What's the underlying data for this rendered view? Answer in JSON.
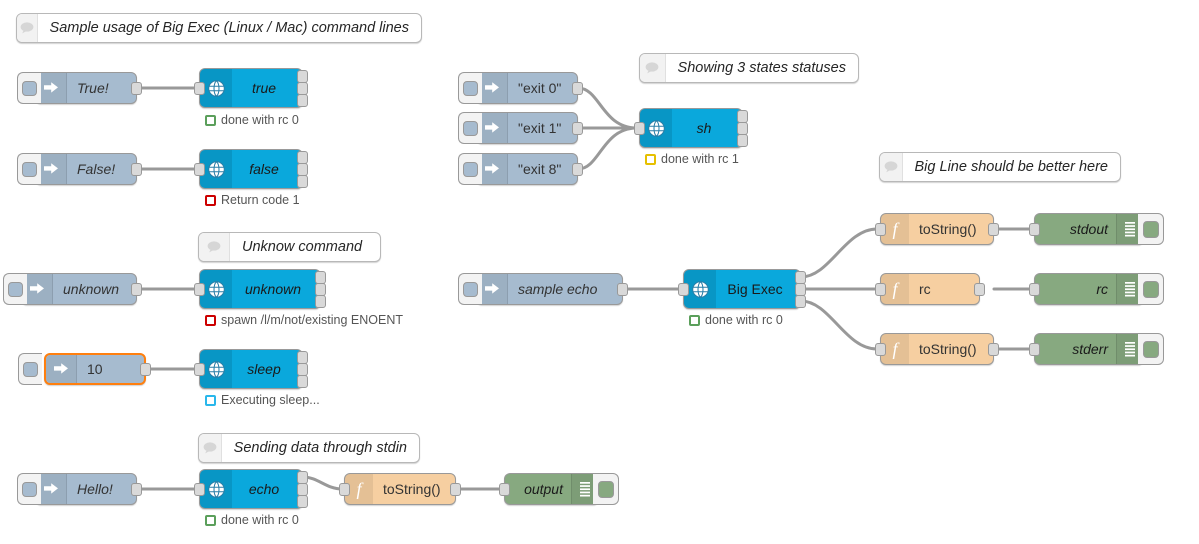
{
  "app": {
    "name": "Node-RED flow editor canvas",
    "background": "#ffffff",
    "colors": {
      "inject": "#a6bbcf",
      "exec": "#0aa8dc",
      "function": "#f6cfa1",
      "debug": "#87a980",
      "comment": "#ffffff",
      "wire": "#999999",
      "selection": "#ff7f0e",
      "status_green": "#5b9f5b",
      "status_red": "#cc0000",
      "status_yellow": "#e6c000",
      "status_blue": "#29b7eb"
    }
  },
  "comments": [
    {
      "id": "c1",
      "text": "Sample usage of Big Exec (Linux / Mac) command lines",
      "icon": "comment-bubble-icon"
    },
    {
      "id": "c2",
      "text": "Showing 3 states statuses",
      "icon": "comment-bubble-icon"
    },
    {
      "id": "c3",
      "text": "Big Line should be better here",
      "icon": "comment-bubble-icon"
    },
    {
      "id": "c4",
      "text": "Unknow command",
      "icon": "comment-bubble-icon"
    },
    {
      "id": "c5",
      "text": "Sending data through stdin",
      "icon": "comment-bubble-icon"
    }
  ],
  "inject_nodes": [
    {
      "id": "i1",
      "label": "True!",
      "italic": true,
      "selected": false,
      "icon": "inject-arrow-icon"
    },
    {
      "id": "i2",
      "label": "False!",
      "italic": true,
      "selected": false,
      "icon": "inject-arrow-icon"
    },
    {
      "id": "i3",
      "label": "unknown",
      "italic": true,
      "selected": false,
      "icon": "inject-arrow-icon"
    },
    {
      "id": "i4",
      "label": "10",
      "italic": false,
      "selected": true,
      "icon": "inject-arrow-icon"
    },
    {
      "id": "i5",
      "label": "Hello!",
      "italic": true,
      "selected": false,
      "icon": "inject-arrow-icon"
    },
    {
      "id": "i6",
      "label": "\"exit 0\"",
      "italic": false,
      "selected": false,
      "icon": "inject-arrow-icon"
    },
    {
      "id": "i7",
      "label": "\"exit 1\"",
      "italic": false,
      "selected": false,
      "icon": "inject-arrow-icon"
    },
    {
      "id": "i8",
      "label": "\"exit 8\"",
      "italic": false,
      "selected": false,
      "icon": "inject-arrow-icon"
    },
    {
      "id": "i9",
      "label": "sample echo",
      "italic": false,
      "selected": false,
      "icon": "inject-arrow-icon"
    }
  ],
  "exec_nodes": [
    {
      "id": "e1",
      "label": "true",
      "italic": true,
      "icon": "globe-icon",
      "status": {
        "text": "done with rc 0",
        "color": "#5b9f5b"
      }
    },
    {
      "id": "e2",
      "label": "false",
      "italic": true,
      "icon": "globe-icon",
      "status": {
        "text": "Return code 1",
        "color": "#cc0000"
      }
    },
    {
      "id": "e3",
      "label": "unknown",
      "italic": true,
      "icon": "globe-icon",
      "status": {
        "text": "spawn /l/m/not/existing ENOENT",
        "color": "#cc0000"
      }
    },
    {
      "id": "e4",
      "label": "sleep",
      "italic": true,
      "icon": "globe-icon",
      "status": {
        "text": "Executing sleep...",
        "color": "#29b7eb"
      }
    },
    {
      "id": "e5",
      "label": "echo",
      "italic": true,
      "icon": "globe-icon",
      "status": {
        "text": "done with rc 0",
        "color": "#5b9f5b"
      }
    },
    {
      "id": "e6",
      "label": "sh",
      "italic": true,
      "icon": "globe-icon",
      "status": {
        "text": "done with rc 1",
        "color": "#e6c000"
      }
    },
    {
      "id": "e7",
      "label": "Big Exec",
      "italic": false,
      "icon": "globe-icon",
      "status": {
        "text": "done with rc 0",
        "color": "#5b9f5b"
      }
    }
  ],
  "function_nodes": [
    {
      "id": "f1",
      "label": "toString()",
      "align": "left",
      "icon": "function-f-icon"
    },
    {
      "id": "f2",
      "label": "toString()",
      "align": "left",
      "icon": "function-f-icon"
    },
    {
      "id": "f3",
      "label": "rc",
      "align": "left",
      "icon": "function-f-icon"
    },
    {
      "id": "f4",
      "label": "toString()",
      "align": "left",
      "icon": "function-f-icon"
    }
  ],
  "debug_nodes": [
    {
      "id": "d1",
      "label": "output",
      "icon": "debug-lines-icon"
    },
    {
      "id": "d2",
      "label": "stdout",
      "icon": "debug-lines-icon"
    },
    {
      "id": "d3",
      "label": "rc",
      "icon": "debug-lines-icon"
    },
    {
      "id": "d4",
      "label": "stderr",
      "icon": "debug-lines-icon"
    }
  ]
}
